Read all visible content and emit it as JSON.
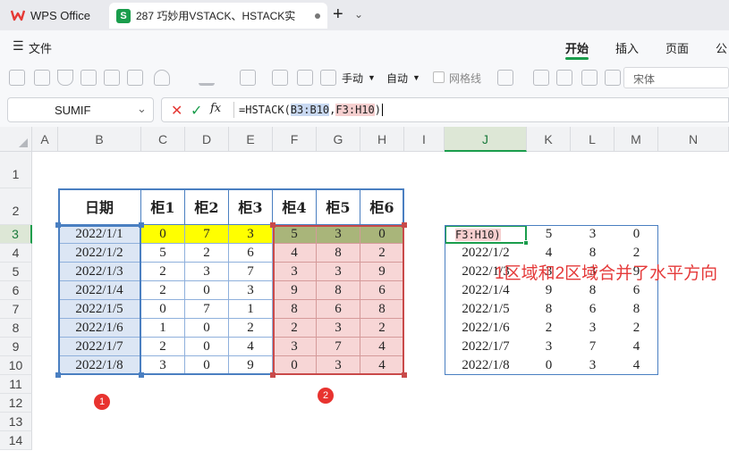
{
  "title_bar": {
    "app_tab": "WPS Office",
    "doc_tab": "287 巧妙用VSTACK、HSTACK实",
    "new_tab": "+",
    "tab_list": "⌄"
  },
  "menu": {
    "file": "文件",
    "items": [
      "开始",
      "插入",
      "页面",
      "公"
    ],
    "active": "开始"
  },
  "toolbar": {
    "manual_label": "手动",
    "auto_label": "自动",
    "gridlines_label": "网格线",
    "font_name": "宋体"
  },
  "formula_bar": {
    "name_box": "SUMIF",
    "formula_prefix": "=HSTACK(",
    "ref1": "B3:B10",
    "sep": ",",
    "ref2": "F3:H10",
    "formula_suffix": ")"
  },
  "columns": [
    "A",
    "B",
    "C",
    "D",
    "E",
    "F",
    "G",
    "H",
    "I",
    "J",
    "K",
    "L",
    "M",
    "N"
  ],
  "rows": [
    "1",
    "2",
    "3",
    "4",
    "5",
    "6",
    "7",
    "8",
    "9",
    "10",
    "11",
    "12",
    "13",
    "14"
  ],
  "table": {
    "headers": [
      "日期",
      "柜1",
      "柜2",
      "柜3",
      "柜4",
      "柜5",
      "柜6"
    ],
    "rows": [
      [
        "2022/1/1",
        "0",
        "7",
        "3",
        "5",
        "3",
        "0"
      ],
      [
        "2022/1/2",
        "5",
        "2",
        "6",
        "4",
        "8",
        "2"
      ],
      [
        "2022/1/3",
        "2",
        "3",
        "7",
        "3",
        "3",
        "9"
      ],
      [
        "2022/1/4",
        "2",
        "0",
        "3",
        "9",
        "8",
        "6"
      ],
      [
        "2022/1/5",
        "0",
        "7",
        "1",
        "8",
        "6",
        "8"
      ],
      [
        "2022/1/6",
        "1",
        "0",
        "2",
        "2",
        "3",
        "2"
      ],
      [
        "2022/1/7",
        "2",
        "0",
        "4",
        "3",
        "7",
        "4"
      ],
      [
        "2022/1/8",
        "3",
        "0",
        "9",
        "0",
        "3",
        "4"
      ]
    ]
  },
  "result": {
    "editing_cell": "F3:H10)",
    "rows": [
      [
        "",
        "5",
        "3",
        "0"
      ],
      [
        "2022/1/2",
        "4",
        "8",
        "2"
      ],
      [
        "2022/1/3",
        "3",
        "3",
        "9"
      ],
      [
        "2022/1/4",
        "9",
        "8",
        "6"
      ],
      [
        "2022/1/5",
        "8",
        "6",
        "8"
      ],
      [
        "2022/1/6",
        "2",
        "3",
        "2"
      ],
      [
        "2022/1/7",
        "3",
        "7",
        "4"
      ],
      [
        "2022/1/8",
        "0",
        "3",
        "4"
      ]
    ]
  },
  "annotations": {
    "badge1": "1",
    "badge2": "2",
    "note": "1区域和2区域合并了水平方向"
  },
  "colors": {
    "yellow_fill": "#ffff00",
    "olive_fill": "#a9b57a",
    "pink_fill": "#f7d6d6",
    "blue_fill": "#dce6f4",
    "blue_border": "#4a7fc1",
    "red_border": "#c94a4a",
    "accent_green": "#1a9d4c"
  }
}
